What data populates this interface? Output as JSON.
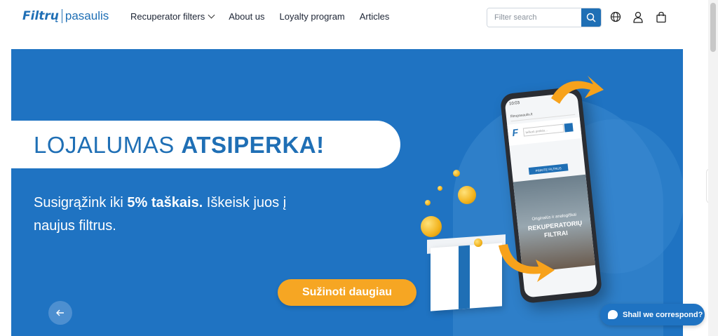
{
  "header": {
    "logo": {
      "brand": "Filtrų",
      "suffix": "pasaulis"
    },
    "nav": [
      {
        "label": "Recuperator filters",
        "has_dropdown": true
      },
      {
        "label": "About us"
      },
      {
        "label": "Loyalty program"
      },
      {
        "label": "Articles"
      }
    ],
    "search": {
      "placeholder": "Filter search",
      "value": ""
    },
    "icons": [
      "search-icon",
      "globe-icon",
      "user-icon",
      "bag-icon"
    ]
  },
  "banner": {
    "title_light": "LOJALUMAS ",
    "title_bold": "ATSIPERKA!",
    "subtitle_pre": "Susigrąžink iki ",
    "subtitle_bold": "5% taškais.",
    "subtitle_post": " Iškeisk juos į naujus filtrus.",
    "cta_label": "Sužinoti daugiau",
    "phone": {
      "time": "10:03",
      "url": "filtrupasaulis.lt",
      "search_placeholder": "Ieškoti prekės...",
      "button_label": "PRIKITE FILTRUS",
      "screen_text_small": "Originalūs ir analogiškai",
      "screen_text_big": "REKUPERATORIŲ FILTRAI"
    }
  },
  "chat": {
    "label": "Shall we correspond?"
  },
  "colors": {
    "brand_blue": "#1f73c2",
    "accent_orange": "#f6a623"
  }
}
